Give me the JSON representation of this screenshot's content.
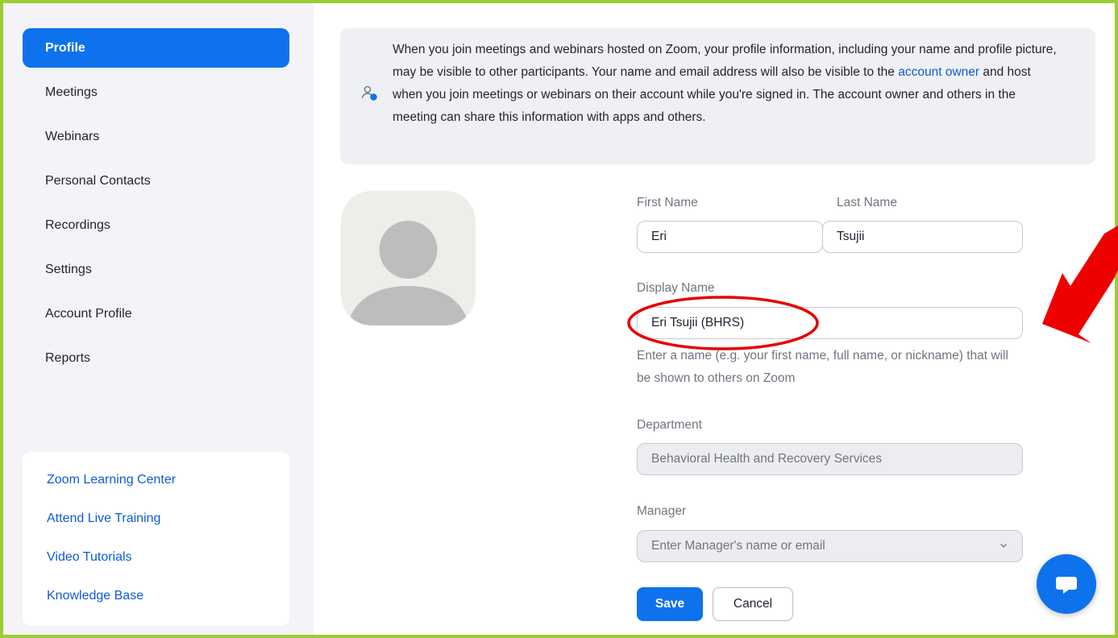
{
  "sidebar": {
    "items": [
      {
        "label": "Profile"
      },
      {
        "label": "Meetings"
      },
      {
        "label": "Webinars"
      },
      {
        "label": "Personal Contacts"
      },
      {
        "label": "Recordings"
      },
      {
        "label": "Settings"
      },
      {
        "label": "Account Profile"
      },
      {
        "label": "Reports"
      }
    ],
    "active_item": "Profile",
    "learning": [
      {
        "label": "Zoom Learning Center"
      },
      {
        "label": "Attend Live Training"
      },
      {
        "label": "Video Tutorials"
      },
      {
        "label": "Knowledge Base"
      }
    ]
  },
  "notice": {
    "text_before": "When you join meetings and webinars hosted on Zoom, your profile information, including your name and profile picture, may be visible to other participants. Your name and email address will also be visible to the ",
    "link": "account owner",
    "text_after": " and host when you join meetings or webinars on their account while you're signed in. The account owner and others in the meeting can share this information with apps and others.",
    "icon": "user-info-icon"
  },
  "profile": {
    "first_name_label": "First Name",
    "first_name_value": "Eri",
    "last_name_label": "Last Name",
    "last_name_value": "Tsujii",
    "display_name_label": "Display Name",
    "display_name_value": "Eri Tsujii (BHRS)",
    "display_name_hint": "Enter a name (e.g. your first name, full name, or nickname) that will be shown to others on Zoom",
    "department_label": "Department",
    "department_value": "Behavioral Health and Recovery Services",
    "manager_label": "Manager",
    "manager_placeholder": "Enter Manager's name or email"
  },
  "actions": {
    "save_label": "Save",
    "cancel_label": "Cancel"
  },
  "colors": {
    "accent": "#0e72ed",
    "frame_border": "#9acd32",
    "annotation": "#e60000"
  }
}
